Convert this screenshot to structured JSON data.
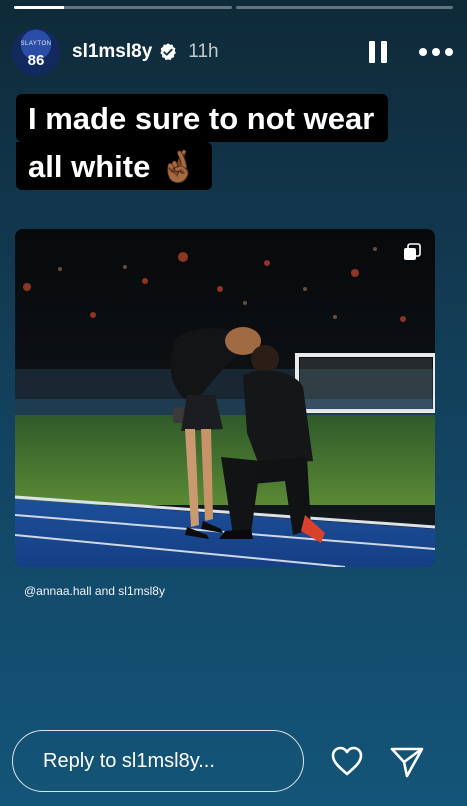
{
  "story": {
    "progress": [
      0.23,
      0.0
    ]
  },
  "header": {
    "username": "sl1msl8y",
    "time_ago": "11h",
    "avatar_name": "SLAYTON",
    "avatar_number": "86",
    "icons": [
      "verified-badge-icon",
      "pause-icon",
      "more-icon"
    ]
  },
  "caption": {
    "line1": "I made sure to not wear",
    "line2": "all white",
    "emoji": "🤞🏾"
  },
  "post": {
    "tagged_user": "@annaa.hall",
    "connector": "and",
    "author": "sl1msl8y"
  },
  "footer": {
    "reply_placeholder": "Reply to sl1msl8y...",
    "icons": [
      "heart-icon",
      "send-icon"
    ]
  }
}
